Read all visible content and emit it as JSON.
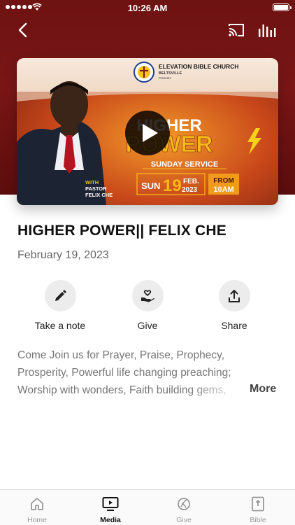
{
  "status_bar": {
    "time": "10:26 AM"
  },
  "colors": {
    "header": "#6e1212",
    "accent": "#e8870e"
  },
  "thumbnail": {
    "church_name": "ELEVATION BIBLE CHURCH",
    "church_location": "BELTSVILLE",
    "presents": "Presents",
    "headline_1": "HIGHER",
    "headline_2": "POWER",
    "service": "SUNDAY SERVICE",
    "with": "WITH",
    "pastor_title": "PASTOR",
    "pastor_name": "FELIX CHE",
    "day": "SUN",
    "day_num": "19",
    "month": "FEB.",
    "year": "2023",
    "from": "FROM",
    "start_time": "10AM"
  },
  "media": {
    "title": "HIGHER POWER|| FELIX CHE",
    "date": "February 19, 2023",
    "description": "Come Join us for Prayer, Praise, Prophecy, Prosperity, Powerful life changing preaching; Worship with wonders, Faith building gems,",
    "more_label": "More"
  },
  "actions": [
    {
      "label": "Take a note",
      "icon": "pencil-icon"
    },
    {
      "label": "Give",
      "icon": "give-hand-heart-icon"
    },
    {
      "label": "Share",
      "icon": "share-icon"
    }
  ],
  "tabs": [
    {
      "label": "Home",
      "icon": "home-icon"
    },
    {
      "label": "Media",
      "icon": "media-play-icon",
      "active": true
    },
    {
      "label": "Give",
      "icon": "give-icon"
    },
    {
      "label": "Bible",
      "icon": "bible-icon"
    }
  ]
}
